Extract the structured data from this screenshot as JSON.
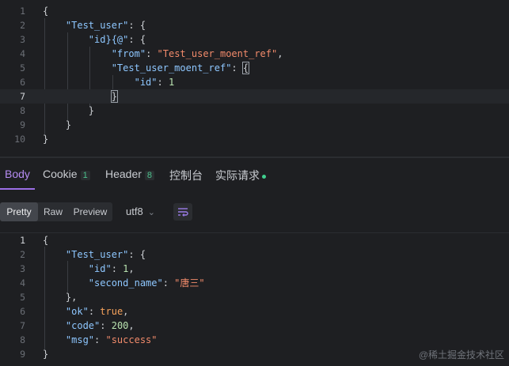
{
  "request_editor": {
    "active_line": 7,
    "lines": [
      {
        "num": "1"
      },
      {
        "num": "2"
      },
      {
        "num": "3"
      },
      {
        "num": "4"
      },
      {
        "num": "5"
      },
      {
        "num": "6"
      },
      {
        "num": "7"
      },
      {
        "num": "8"
      },
      {
        "num": "9"
      },
      {
        "num": "10"
      }
    ],
    "tokens": {
      "open_brace": "{",
      "key_test_user": "\"Test_user\"",
      "colon_brace": ": {",
      "key_id_at": "\"id}{@\"",
      "key_from": "\"from\"",
      "colon": ": ",
      "str_from": "\"Test_user_moent_ref\"",
      "comma": ",",
      "key_ref": "\"Test_user_moent_ref\"",
      "colon_only": ": ",
      "brace_open_boxed": "{",
      "key_id": "\"id\"",
      "num_id": "1",
      "brace_close_boxed": "}",
      "close_brace": "}"
    }
  },
  "tabs": {
    "body": "Body",
    "cookie": "Cookie",
    "cookie_count": "1",
    "header": "Header",
    "header_count": "8",
    "console": "控制台",
    "actual_request": "实际请求"
  },
  "toolbar": {
    "pretty": "Pretty",
    "raw": "Raw",
    "preview": "Preview",
    "encoding": "utf8"
  },
  "response": {
    "lines": [
      {
        "num": "1"
      },
      {
        "num": "2"
      },
      {
        "num": "3"
      },
      {
        "num": "4"
      },
      {
        "num": "5"
      },
      {
        "num": "6"
      },
      {
        "num": "7"
      },
      {
        "num": "8"
      },
      {
        "num": "9"
      }
    ],
    "tokens": {
      "open": "{",
      "key_test_user": "\"Test_user\"",
      "colon_brace": ": {",
      "key_id": "\"id\"",
      "val_id": "1",
      "key_second_name": "\"second_name\"",
      "val_second_name": "\"唐三\"",
      "close_comma": "},",
      "key_ok": "\"ok\"",
      "val_ok": "true",
      "key_code": "\"code\"",
      "val_code": "200",
      "key_msg": "\"msg\"",
      "val_msg": "\"success\"",
      "close": "}"
    }
  },
  "watermark": "@稀土掘金技术社区"
}
